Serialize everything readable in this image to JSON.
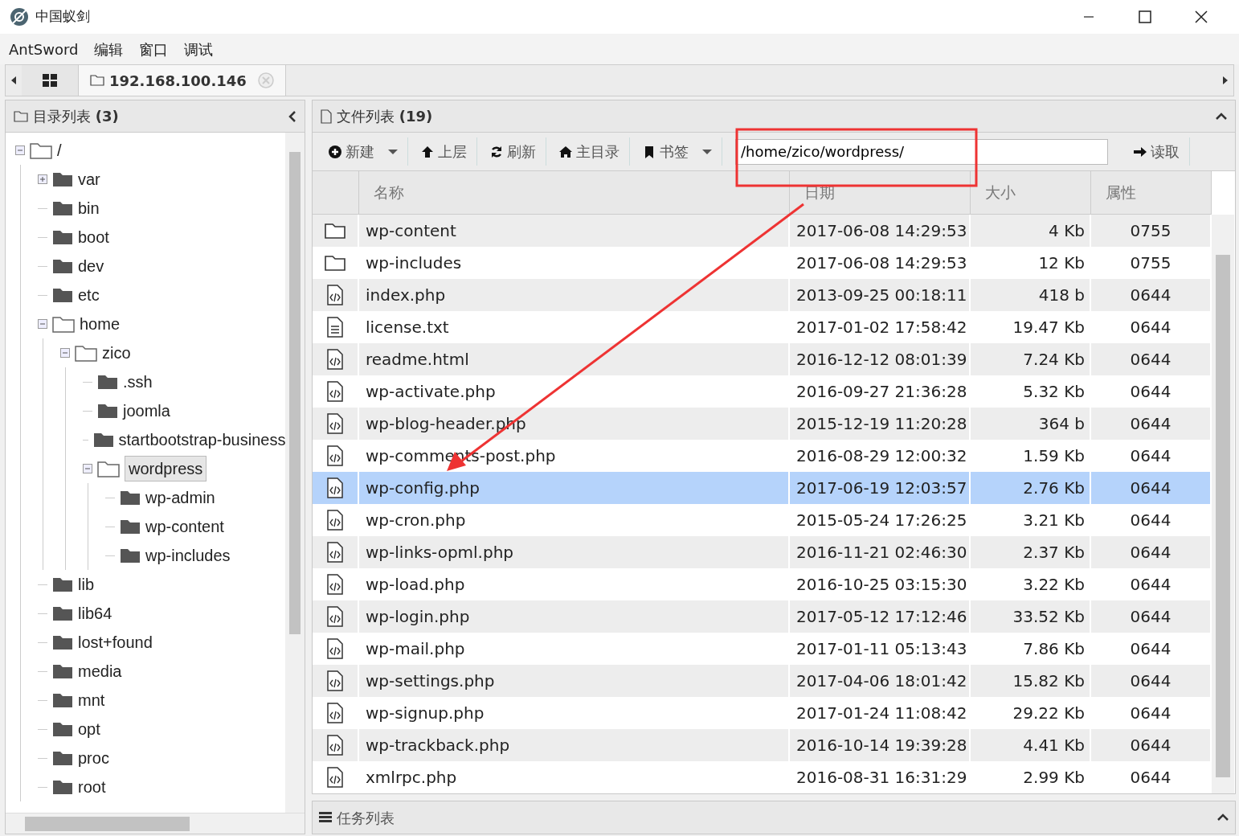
{
  "window": {
    "title": "中国蚁剑"
  },
  "menu": [
    "AntSword",
    "编辑",
    "窗口",
    "调试"
  ],
  "tabs": [
    {
      "kind": "home",
      "selected": false
    },
    {
      "kind": "shell",
      "label": "192.168.100.146",
      "selected": true
    }
  ],
  "directory_panel": {
    "title": "目录列表",
    "count": "(3)"
  },
  "tree": [
    {
      "name": "/",
      "expanded": true,
      "selected": false,
      "children": [
        {
          "name": "var",
          "expanded": false,
          "selected": false
        },
        {
          "name": "bin",
          "selected": false
        },
        {
          "name": "boot",
          "selected": false
        },
        {
          "name": "dev",
          "selected": false
        },
        {
          "name": "etc",
          "selected": false
        },
        {
          "name": "home",
          "expanded": true,
          "selected": false,
          "children": [
            {
              "name": "zico",
              "expanded": true,
              "selected": false,
              "children": [
                {
                  "name": ".ssh",
                  "selected": false
                },
                {
                  "name": "joomla",
                  "selected": false
                },
                {
                  "name": "startbootstrap-business",
                  "selected": false
                },
                {
                  "name": "wordpress",
                  "expanded": true,
                  "selected": true,
                  "children": [
                    {
                      "name": "wp-admin",
                      "selected": false
                    },
                    {
                      "name": "wp-content",
                      "selected": false
                    },
                    {
                      "name": "wp-includes",
                      "selected": false
                    }
                  ]
                }
              ]
            }
          ]
        },
        {
          "name": "lib",
          "selected": false
        },
        {
          "name": "lib64",
          "selected": false
        },
        {
          "name": "lost+found",
          "selected": false
        },
        {
          "name": "media",
          "selected": false
        },
        {
          "name": "mnt",
          "selected": false
        },
        {
          "name": "opt",
          "selected": false
        },
        {
          "name": "proc",
          "selected": false
        },
        {
          "name": "root",
          "selected": false
        }
      ]
    }
  ],
  "file_panel": {
    "title": "文件列表",
    "count": "(19)"
  },
  "toolbar": [
    {
      "kind": "new",
      "label": "新建",
      "dropdown": true
    },
    {
      "kind": "up",
      "label": "上层"
    },
    {
      "kind": "refresh",
      "label": "刷新"
    },
    {
      "kind": "home",
      "label": "主目录"
    },
    {
      "kind": "bookmark",
      "label": "书签",
      "dropdown": true
    }
  ],
  "path": {
    "value": "/home/zico/wordpress/"
  },
  "read_button": "读取",
  "table": {
    "columns": [
      "名称",
      "日期",
      "大小",
      "属性"
    ],
    "rows": [
      {
        "kind": "folder",
        "name": "wp-content",
        "date": "2017-06-08 14:29:53",
        "size": "4 Kb",
        "mode": "0755",
        "selected": false
      },
      {
        "kind": "folder",
        "name": "wp-includes",
        "date": "2017-06-08 14:29:53",
        "size": "12 Kb",
        "mode": "0755",
        "selected": false
      },
      {
        "kind": "code",
        "name": "index.php",
        "date": "2013-09-25 00:18:11",
        "size": "418 b",
        "mode": "0644",
        "selected": false
      },
      {
        "kind": "text",
        "name": "license.txt",
        "date": "2017-01-02 17:58:42",
        "size": "19.47 Kb",
        "mode": "0644",
        "selected": false
      },
      {
        "kind": "code",
        "name": "readme.html",
        "date": "2016-12-12 08:01:39",
        "size": "7.24 Kb",
        "mode": "0644",
        "selected": false
      },
      {
        "kind": "code",
        "name": "wp-activate.php",
        "date": "2016-09-27 21:36:28",
        "size": "5.32 Kb",
        "mode": "0644",
        "selected": false
      },
      {
        "kind": "code",
        "name": "wp-blog-header.php",
        "date": "2015-12-19 11:20:28",
        "size": "364 b",
        "mode": "0644",
        "selected": false
      },
      {
        "kind": "code",
        "name": "wp-comments-post.php",
        "date": "2016-08-29 12:00:32",
        "size": "1.59 Kb",
        "mode": "0644",
        "selected": false
      },
      {
        "kind": "code",
        "name": "wp-config.php",
        "date": "2017-06-19 12:03:57",
        "size": "2.76 Kb",
        "mode": "0644",
        "selected": true
      },
      {
        "kind": "code",
        "name": "wp-cron.php",
        "date": "2015-05-24 17:26:25",
        "size": "3.21 Kb",
        "mode": "0644",
        "selected": false
      },
      {
        "kind": "code",
        "name": "wp-links-opml.php",
        "date": "2016-11-21 02:46:30",
        "size": "2.37 Kb",
        "mode": "0644",
        "selected": false
      },
      {
        "kind": "code",
        "name": "wp-load.php",
        "date": "2016-10-25 03:15:30",
        "size": "3.22 Kb",
        "mode": "0644",
        "selected": false
      },
      {
        "kind": "code",
        "name": "wp-login.php",
        "date": "2017-05-12 17:12:46",
        "size": "33.52 Kb",
        "mode": "0644",
        "selected": false
      },
      {
        "kind": "code",
        "name": "wp-mail.php",
        "date": "2017-01-11 05:13:43",
        "size": "7.86 Kb",
        "mode": "0644",
        "selected": false
      },
      {
        "kind": "code",
        "name": "wp-settings.php",
        "date": "2017-04-06 18:01:42",
        "size": "15.82 Kb",
        "mode": "0644",
        "selected": false
      },
      {
        "kind": "code",
        "name": "wp-signup.php",
        "date": "2017-01-24 11:08:42",
        "size": "29.22 Kb",
        "mode": "0644",
        "selected": false
      },
      {
        "kind": "code",
        "name": "wp-trackback.php",
        "date": "2016-10-14 19:39:28",
        "size": "4.41 Kb",
        "mode": "0644",
        "selected": false
      },
      {
        "kind": "code",
        "name": "xmlrpc.php",
        "date": "2016-08-31 16:31:29",
        "size": "2.99 Kb",
        "mode": "0644",
        "selected": false
      }
    ]
  },
  "task_panel": {
    "title": "任务列表"
  },
  "annotations": {
    "highlight_box": true,
    "pointer_arrow": true
  }
}
